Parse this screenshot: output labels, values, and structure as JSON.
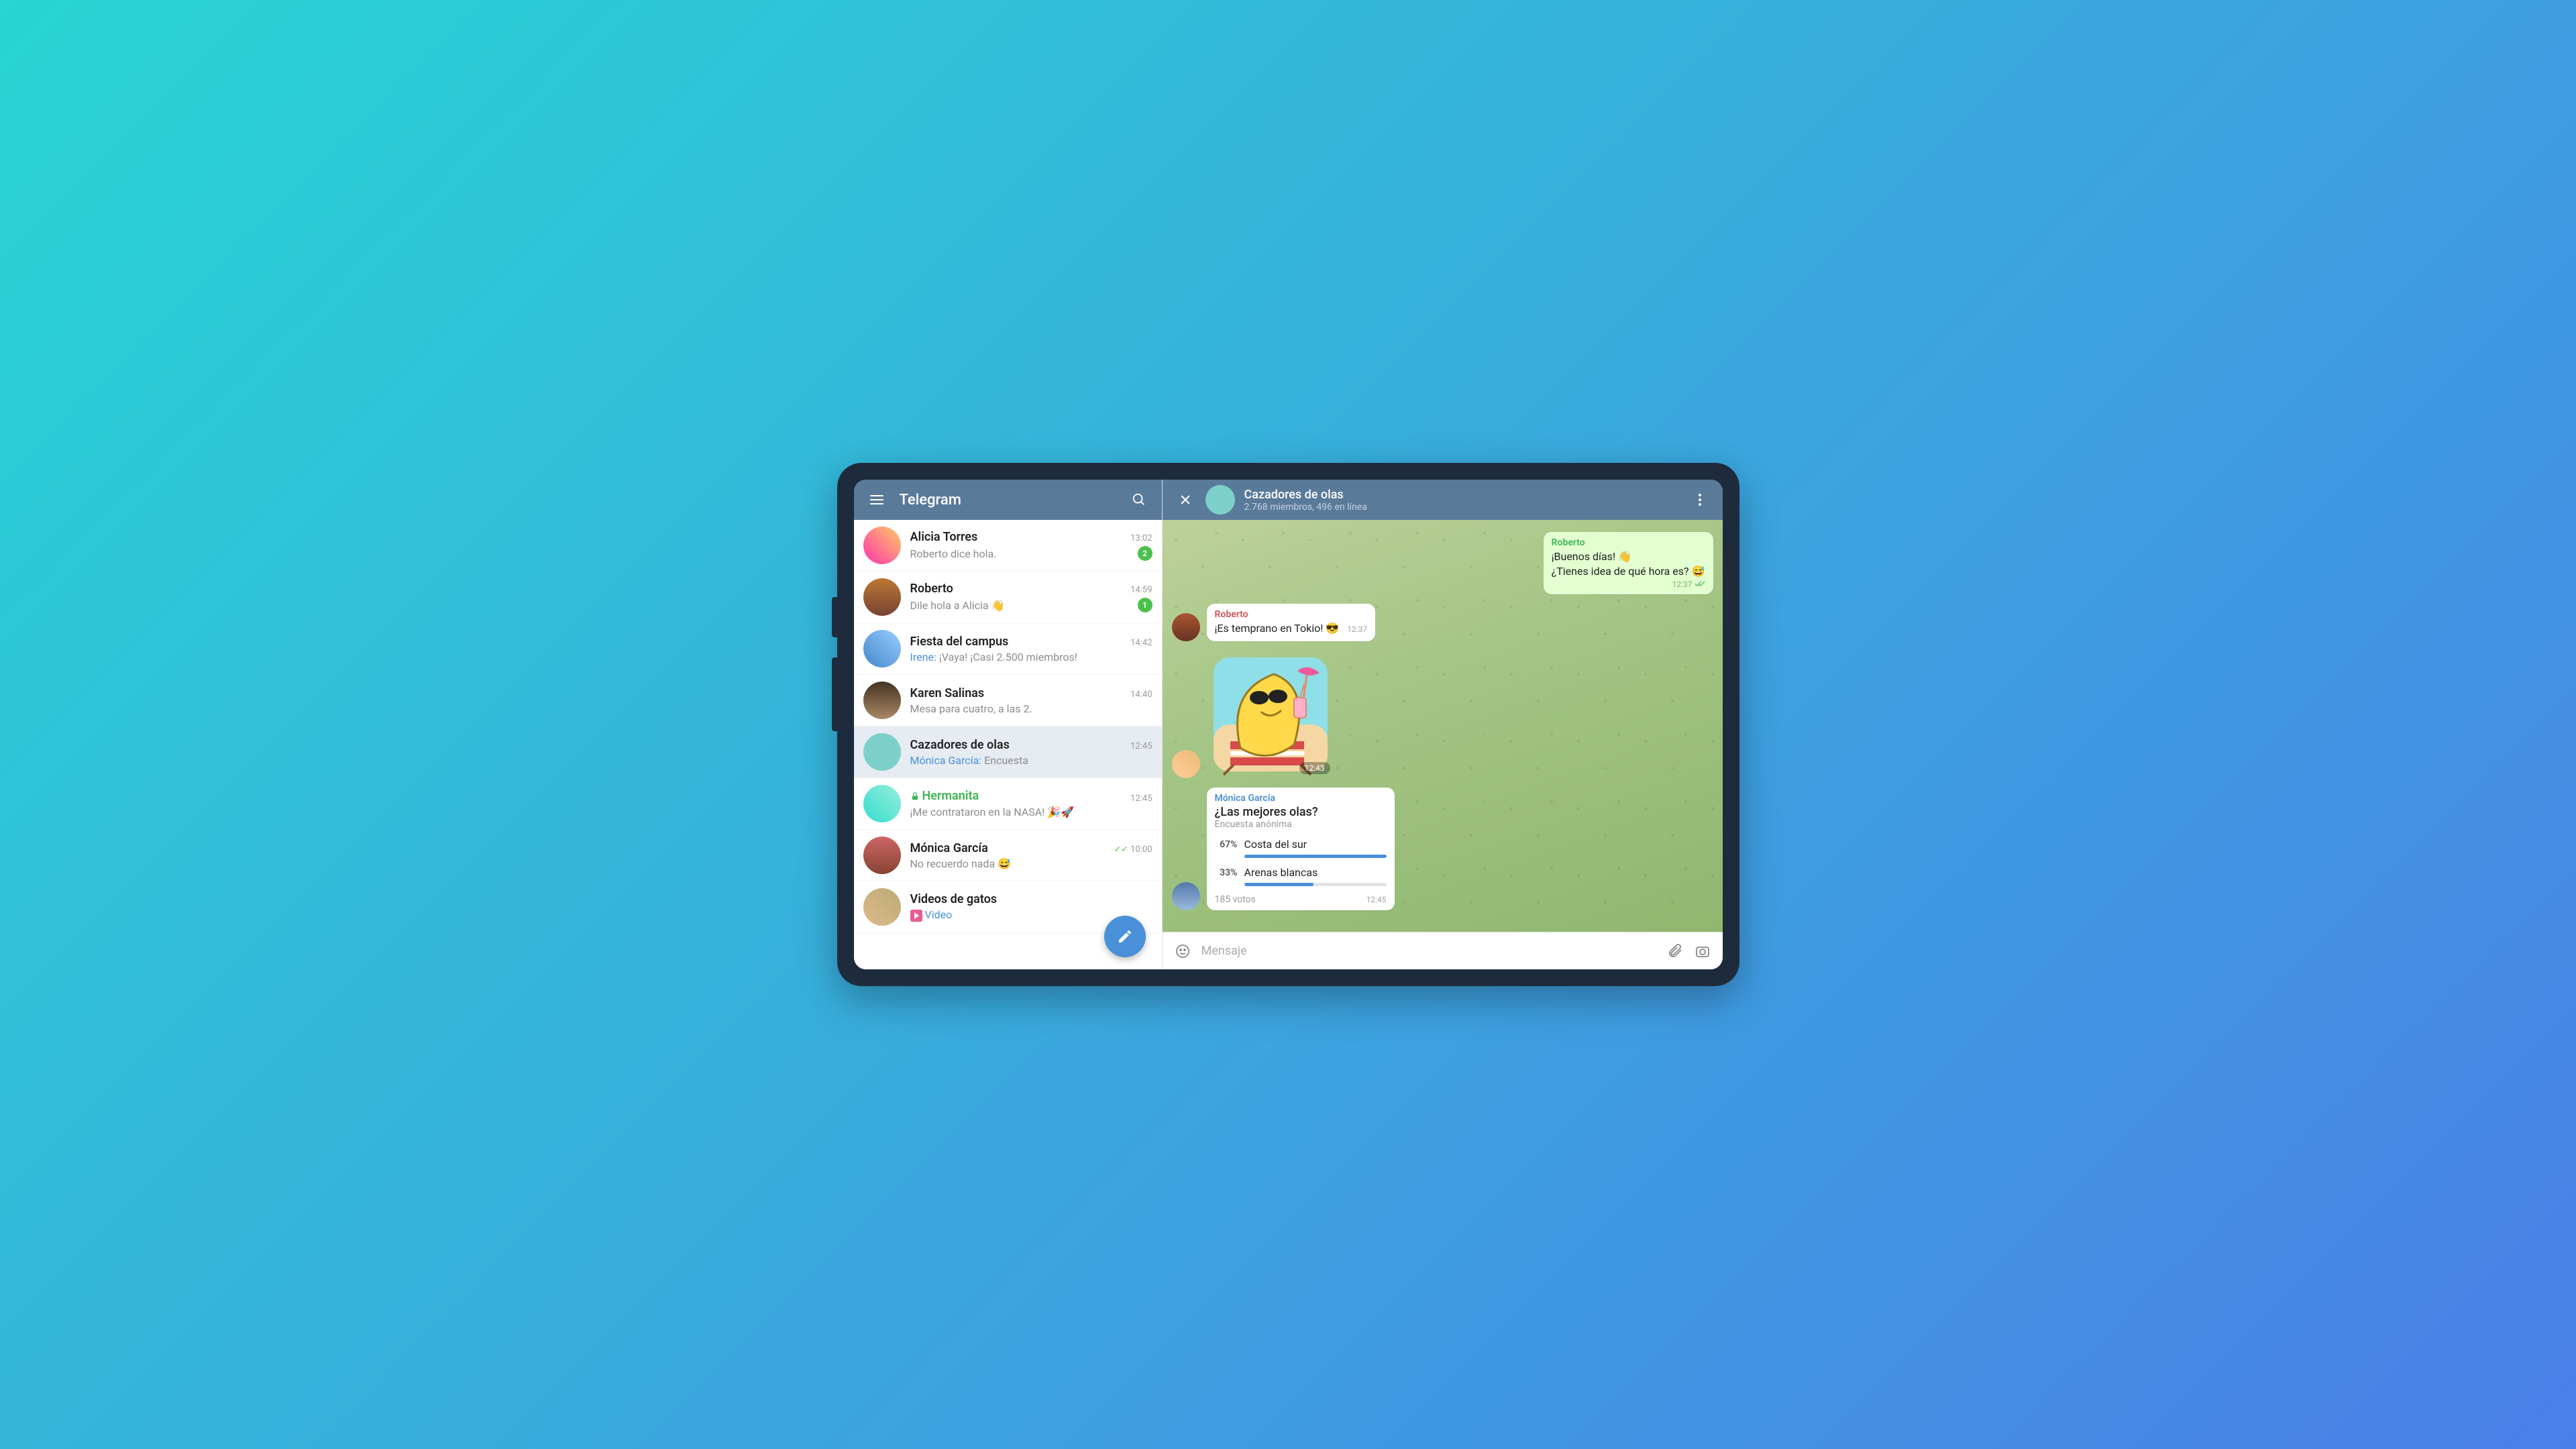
{
  "app": {
    "title": "Telegram"
  },
  "chats": [
    {
      "name": "Alicia Torres",
      "preview": "Roberto dice hola.",
      "time": "13:02",
      "badge": "2",
      "secret": false
    },
    {
      "name": "Roberto",
      "preview": "Dile hola a Alicia 👋",
      "time": "14:59",
      "badge": "1",
      "secret": false
    },
    {
      "name": "Fiesta del campus",
      "sender": "Irene:",
      "preview_text": "¡Vaya! ¡Casi 2.500 miembros!",
      "time": "14:42",
      "secret": false
    },
    {
      "name": "Karen Salinas",
      "preview": "Mesa para cuatro, a las 2.",
      "time": "14:40",
      "secret": false
    },
    {
      "name": "Cazadores de olas",
      "sender": "Mónica García:",
      "preview_text": "Encuesta",
      "time": "12:45",
      "secret": false,
      "active": true
    },
    {
      "name": "Hermanita",
      "preview": "¡Me contrataron en la NASA! 🎉🚀",
      "time": "12:45",
      "secret": true
    },
    {
      "name": "Mónica García",
      "preview": "No recuerdo nada 😅",
      "time": "10:00",
      "read": true,
      "secret": false
    },
    {
      "name": "Videos de gatos",
      "media_label": "Video",
      "time": "",
      "secret": false
    }
  ],
  "conversation": {
    "title": "Cazadores de olas",
    "subtitle": "2.768 miembros, 496 en línea"
  },
  "messages": {
    "out1": {
      "sender": "Roberto",
      "line1": "¡Buenos días! 👋",
      "line2": "¿Tienes idea de qué hora es? 😅",
      "time": "12:37"
    },
    "in1": {
      "sender": "Roberto",
      "text": "¡Es temprano en Tokio! 😎",
      "time": "12:37"
    },
    "sticker": {
      "time": "12:43"
    },
    "poll": {
      "sender": "Mónica García",
      "question": "¿Las mejores olas?",
      "subtitle": "Encuesta anónima",
      "options": [
        {
          "pct": "67%",
          "label": "Costa del sur",
          "fill": 67
        },
        {
          "pct": "33%",
          "label": "Arenas blancas",
          "fill": 33
        }
      ],
      "votes": "185 votos",
      "time": "12:45"
    }
  },
  "input": {
    "placeholder": "Mensaje"
  }
}
